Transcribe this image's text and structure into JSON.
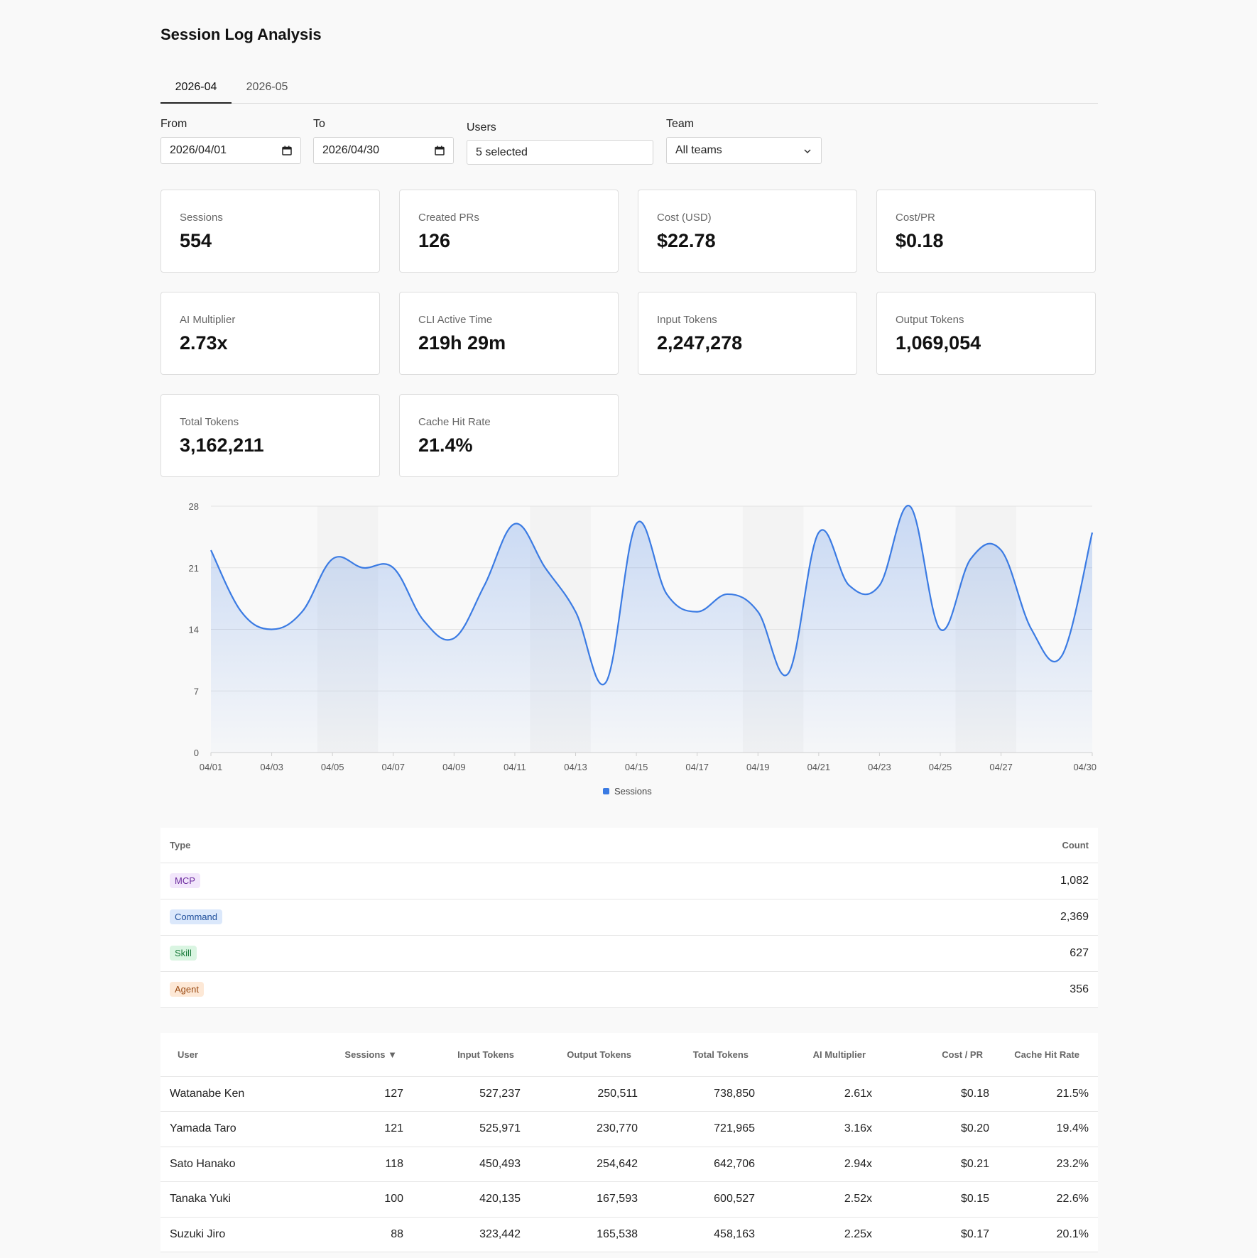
{
  "page": {
    "title": "Session Log Analysis"
  },
  "tabs": [
    {
      "label": "2026-04",
      "active": true
    },
    {
      "label": "2026-05",
      "active": false
    }
  ],
  "filters": {
    "from": {
      "label": "From",
      "value": "2026/04/01"
    },
    "to": {
      "label": "To",
      "value": "2026/04/30"
    },
    "users": {
      "label": "Users",
      "value": "5 selected"
    },
    "team": {
      "label": "Team",
      "value": "All teams",
      "options": [
        "All teams"
      ]
    }
  },
  "metrics": [
    {
      "label": "Sessions",
      "value": "554"
    },
    {
      "label": "Created PRs",
      "value": "126"
    },
    {
      "label": "Cost (USD)",
      "value": "$22.78"
    },
    {
      "label": "Cost/PR",
      "value": "$0.18"
    },
    {
      "label": "AI Multiplier",
      "value": "2.73x"
    },
    {
      "label": "CLI Active Time",
      "value": "219h 29m"
    },
    {
      "label": "Input Tokens",
      "value": "2,247,278"
    },
    {
      "label": "Output Tokens",
      "value": "1,069,054"
    },
    {
      "label": "Total Tokens",
      "value": "3,162,211"
    },
    {
      "label": "Cache Hit Rate",
      "value": "21.4%"
    }
  ],
  "chart_data": {
    "type": "area",
    "x": [
      "04/01",
      "04/02",
      "04/03",
      "04/04",
      "04/05",
      "04/06",
      "04/07",
      "04/08",
      "04/09",
      "04/10",
      "04/11",
      "04/12",
      "04/13",
      "04/14",
      "04/15",
      "04/16",
      "04/17",
      "04/18",
      "04/19",
      "04/20",
      "04/21",
      "04/22",
      "04/23",
      "04/24",
      "04/25",
      "04/26",
      "04/27",
      "04/28",
      "04/29",
      "04/30"
    ],
    "x_tick_labels": [
      "04/01",
      "04/03",
      "04/05",
      "04/07",
      "04/09",
      "04/11",
      "04/13",
      "04/15",
      "04/17",
      "04/19",
      "04/21",
      "04/23",
      "04/25",
      "04/27",
      "04/30"
    ],
    "series": [
      {
        "name": "Sessions",
        "values": [
          23,
          16,
          14,
          16,
          22,
          21,
          21,
          15,
          13,
          19,
          26,
          21,
          16,
          8,
          26,
          18,
          16,
          18,
          16,
          9,
          25,
          19,
          19,
          28,
          14,
          22,
          23,
          14,
          11,
          25
        ]
      }
    ],
    "y_ticks": [
      "0",
      "7",
      "14",
      "21",
      "28"
    ],
    "ylim": [
      0,
      28
    ],
    "grid": true,
    "legend": "bottom-center",
    "weekend_bands": [
      [
        "04/04",
        "04/06"
      ],
      [
        "04/11",
        "04/13"
      ],
      [
        "04/18",
        "04/20"
      ],
      [
        "04/25",
        "04/27"
      ]
    ],
    "colors": {
      "line": "#3b7be3",
      "fill": "#3b7be3"
    }
  },
  "types_table": {
    "columns": [
      "Type",
      "Count"
    ],
    "rows": [
      {
        "type": "MCP",
        "count": "1,082",
        "bg": "#f2e6fb",
        "fg": "#6b2a9e"
      },
      {
        "type": "Command",
        "count": "2,369",
        "bg": "#dbe8fb",
        "fg": "#1f4f9b"
      },
      {
        "type": "Skill",
        "count": "627",
        "bg": "#daf5e2",
        "fg": "#187a3a"
      },
      {
        "type": "Agent",
        "count": "356",
        "bg": "#fde8d6",
        "fg": "#9a4a12"
      }
    ]
  },
  "users_table": {
    "columns": [
      "User",
      "Sessions ▼",
      "Input Tokens",
      "Output Tokens",
      "Total Tokens",
      "AI Multiplier",
      "Cost / PR",
      "Cache Hit Rate"
    ],
    "rows": [
      [
        "Watanabe Ken",
        "127",
        "527,237",
        "250,511",
        "738,850",
        "2.61x",
        "$0.18",
        "21.5%"
      ],
      [
        "Yamada Taro",
        "121",
        "525,971",
        "230,770",
        "721,965",
        "3.16x",
        "$0.20",
        "19.4%"
      ],
      [
        "Sato Hanako",
        "118",
        "450,493",
        "254,642",
        "642,706",
        "2.94x",
        "$0.21",
        "23.2%"
      ],
      [
        "Tanaka Yuki",
        "100",
        "420,135",
        "167,593",
        "600,527",
        "2.52x",
        "$0.15",
        "22.6%"
      ],
      [
        "Suzuki Jiro",
        "88",
        "323,442",
        "165,538",
        "458,163",
        "2.25x",
        "$0.17",
        "20.1%"
      ]
    ]
  }
}
